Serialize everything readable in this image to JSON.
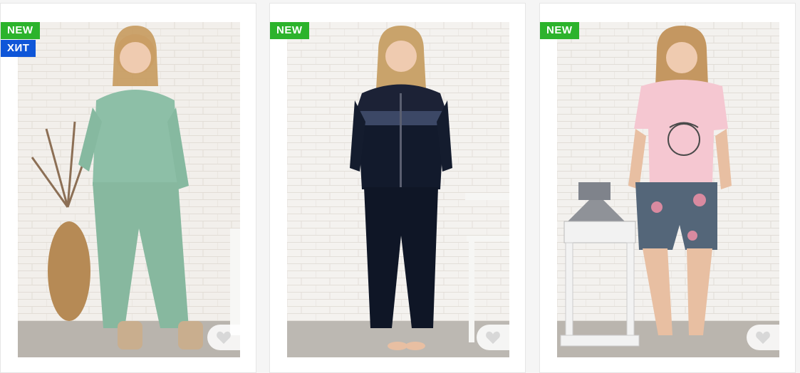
{
  "products": [
    {
      "badges": [
        "NEW",
        "ХИТ"
      ],
      "image_icon": "green-fleece-tracksuit-photo",
      "favorite_icon": "heart-icon"
    },
    {
      "badges": [
        "NEW"
      ],
      "image_icon": "navy-velour-zip-tracksuit-photo",
      "favorite_icon": "heart-icon"
    },
    {
      "badges": [
        "NEW"
      ],
      "image_icon": "pink-tshirt-floral-shorts-photo",
      "favorite_icon": "heart-icon"
    }
  ],
  "colors": {
    "badge_new": "#2cb32c",
    "badge_hit": "#0f56d8"
  }
}
